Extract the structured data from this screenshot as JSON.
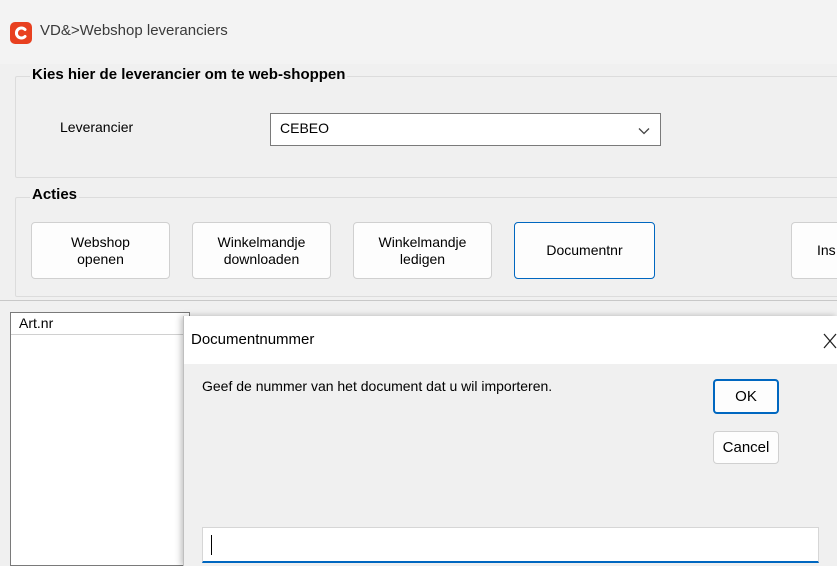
{
  "window": {
    "title": "VD&>Webshop leveranciers",
    "icon": "app-logo-icon",
    "accent": "#e8401f"
  },
  "supplier_group": {
    "label": "Kies hier de leverancier om te web-shoppen",
    "field_label": "Leverancier",
    "selected": "CEBEO"
  },
  "actions_group": {
    "label": "Acties",
    "buttons": [
      {
        "line1": "Webshop",
        "line2": "openen"
      },
      {
        "line1": "Winkelmandje",
        "line2": "downloaden"
      },
      {
        "line1": "Winkelmandje",
        "line2": "ledigen"
      },
      {
        "line1": "Documentnr"
      },
      {
        "line1": "Ins"
      }
    ]
  },
  "grid": {
    "columns": [
      "Art.nr"
    ]
  },
  "dialog": {
    "title": "Documentnummer",
    "prompt": "Geef de nummer van het document dat u wil importeren.",
    "ok_label": "OK",
    "cancel_label": "Cancel",
    "input_value": "",
    "accent": "#0067c0"
  }
}
